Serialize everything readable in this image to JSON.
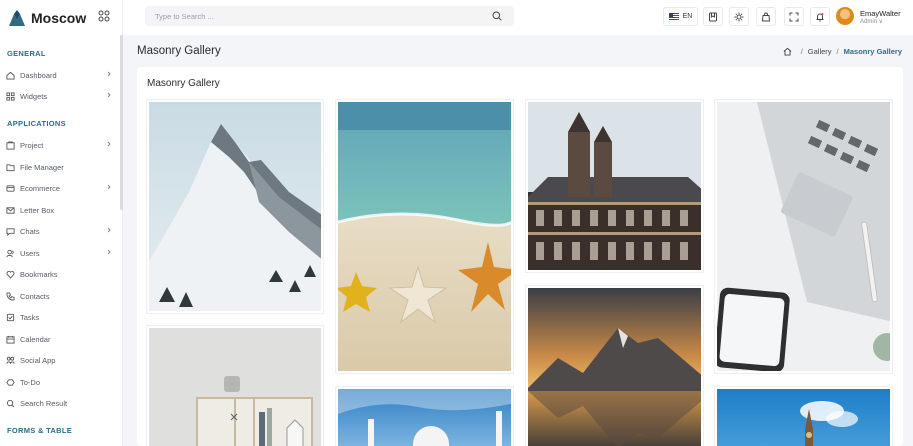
{
  "brand": {
    "name": "Moscow"
  },
  "search": {
    "placeholder": "Type to Search ..."
  },
  "header": {
    "language": "EN",
    "user_name": "EmayWalter",
    "user_role": "Admin ∨"
  },
  "sidebar": {
    "sections": [
      "GENERAL",
      "APPLICATIONS",
      "FORMS & TABLE"
    ],
    "items": [
      {
        "label": "Dashboard",
        "icon": "home-icon"
      },
      {
        "label": "Widgets",
        "icon": "widgets-icon"
      },
      {
        "label": "Project",
        "icon": "project-icon"
      },
      {
        "label": "File Manager",
        "icon": "folder-icon"
      },
      {
        "label": "Ecommerce",
        "icon": "cart-icon"
      },
      {
        "label": "Letter Box",
        "icon": "mail-icon"
      },
      {
        "label": "Chats",
        "icon": "chat-icon"
      },
      {
        "label": "Users",
        "icon": "users-icon"
      },
      {
        "label": "Bookmarks",
        "icon": "heart-icon"
      },
      {
        "label": "Contacts",
        "icon": "phone-icon"
      },
      {
        "label": "Tasks",
        "icon": "tasks-icon"
      },
      {
        "label": "Calendar",
        "icon": "calendar-icon"
      },
      {
        "label": "Social App",
        "icon": "social-icon"
      },
      {
        "label": "To-Do",
        "icon": "todo-icon"
      },
      {
        "label": "Search Result",
        "icon": "search-icon"
      }
    ]
  },
  "page": {
    "title": "Masonry Gallery",
    "breadcrumb": [
      "Gallery",
      "Masonry Gallery"
    ],
    "card_title": "Masonry Gallery"
  },
  "gallery": [
    "snowy-mountain",
    "beach-starfish",
    "white-interior-shelf",
    "old-building",
    "mountain-lake-sunset",
    "mosque-blue-sky",
    "laptop-phone-desk",
    "tower-blue-sky"
  ],
  "colors": {
    "accent": "#2e6c86",
    "background": "#f4f5f8"
  }
}
